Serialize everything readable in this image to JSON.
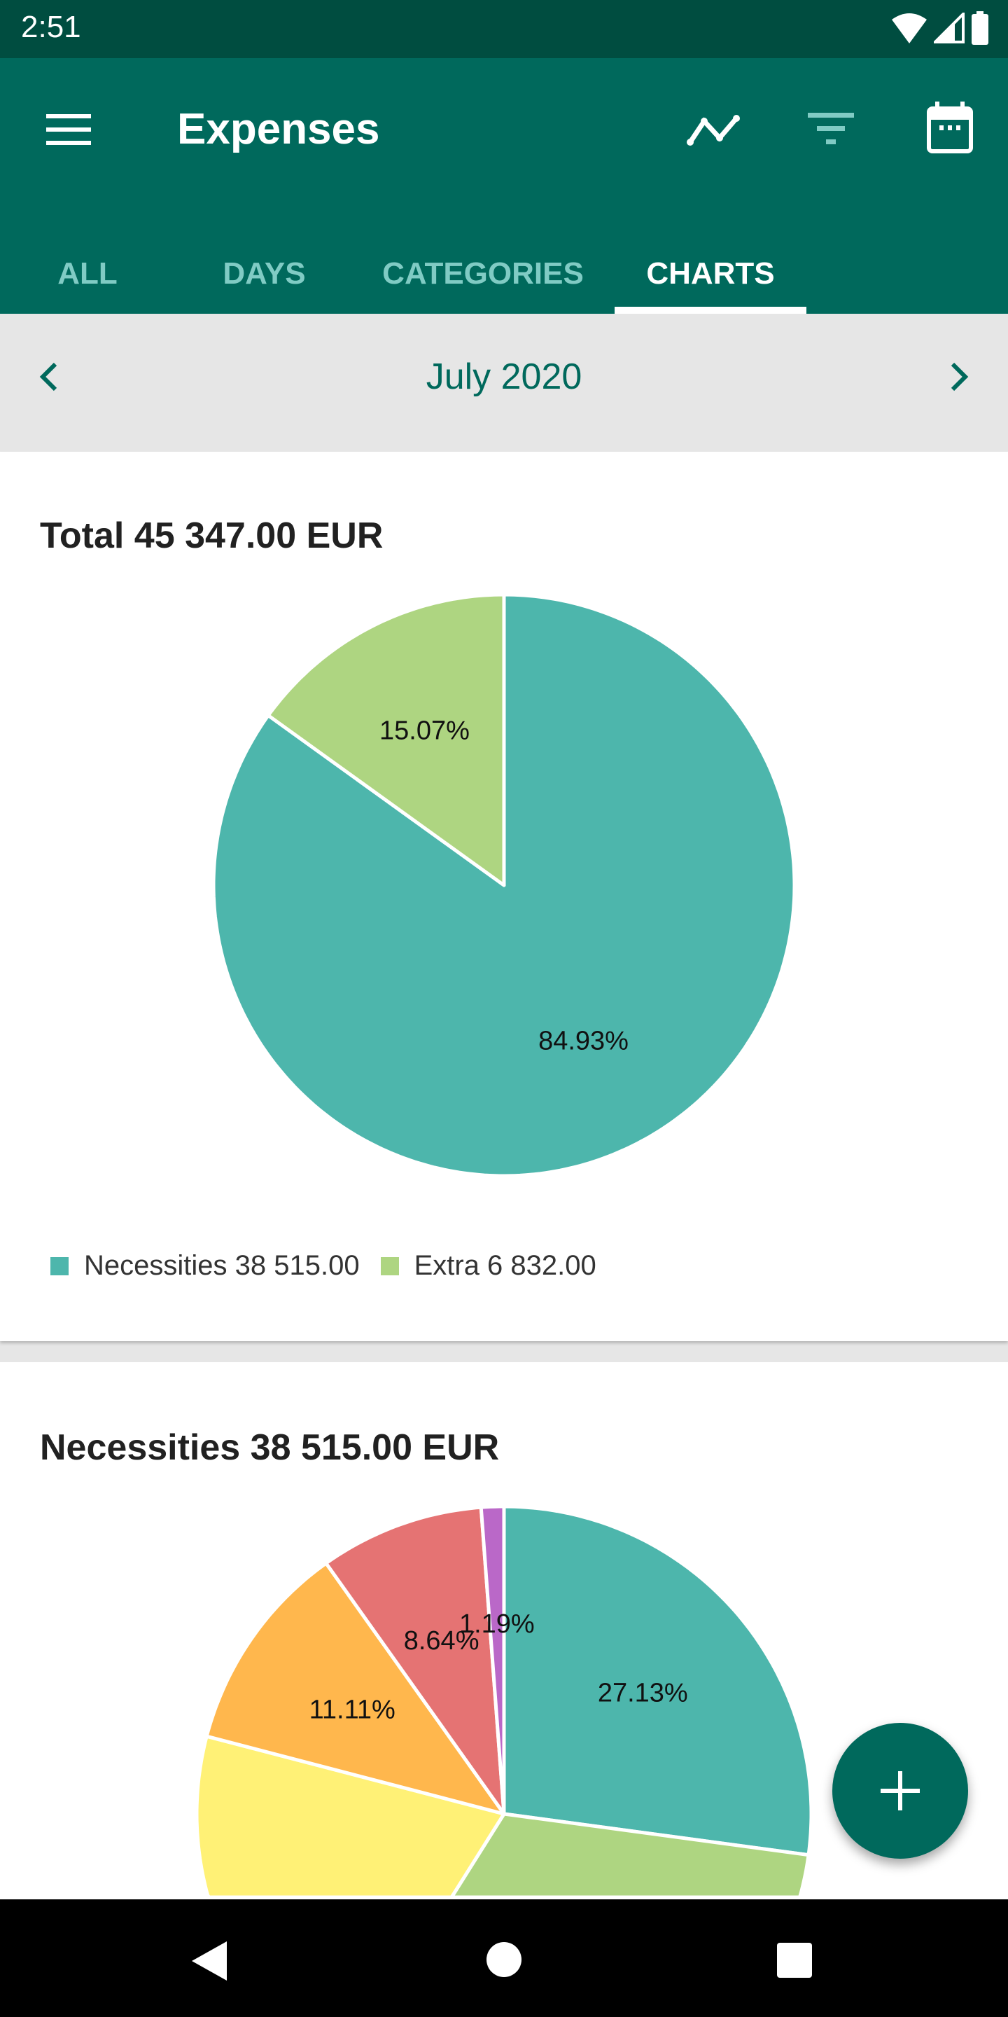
{
  "status_bar": {
    "time": "2:51",
    "icons": [
      "wifi-icon",
      "signal-icon",
      "battery-icon"
    ]
  },
  "app_bar": {
    "title": "Expenses",
    "actions": [
      "trend-chart-icon",
      "filter-icon",
      "calendar-icon"
    ],
    "menu_icon": "hamburger-menu-icon"
  },
  "tabs": [
    {
      "label": "ALL"
    },
    {
      "label": "DAYS"
    },
    {
      "label": "CATEGORIES"
    },
    {
      "label": "CHARTS",
      "active": true
    }
  ],
  "period": {
    "label": "July 2020",
    "prev_icon": "chevron-left-icon",
    "next_icon": "chevron-right-icon"
  },
  "colors": {
    "primary": "#00695c",
    "primary_dark": "#004d40",
    "tab_inactive": "#80cbc4"
  },
  "chart_data": [
    {
      "type": "pie",
      "title": "Total 45 347.00 EUR",
      "slices": [
        {
          "name": "Necessities",
          "value": 38515.0,
          "percent": 84.93,
          "label": "84.93%",
          "color": "#4db6ac"
        },
        {
          "name": "Extra",
          "value": 6832.0,
          "percent": 15.07,
          "label": "15.07%",
          "color": "#aed581"
        }
      ],
      "legend": [
        {
          "text": "Necessities 38 515.00",
          "color": "#4db6ac"
        },
        {
          "text": "Extra 6 832.00",
          "color": "#aed581"
        }
      ],
      "legend_position": "bottom-left"
    },
    {
      "type": "pie",
      "title": "Necessities 38 515.00 EUR",
      "slices": [
        {
          "percent": 27.13,
          "label": "27.13%",
          "color": "#4db6ac"
        },
        {
          "percent": 25.6,
          "color": "#aed581"
        },
        {
          "percent": 26.33,
          "color": "#fff176"
        },
        {
          "percent": 11.11,
          "label": "11.11%",
          "color": "#ffb74d"
        },
        {
          "percent": 8.64,
          "label": "8.64%",
          "color": "#e57373"
        },
        {
          "percent": 1.19,
          "label": "1.19%",
          "color": "#ba68c8"
        }
      ]
    }
  ],
  "fab": {
    "icon": "plus-icon"
  },
  "nav_bar": {
    "icons": [
      "back-icon",
      "home-icon",
      "recents-icon"
    ]
  }
}
